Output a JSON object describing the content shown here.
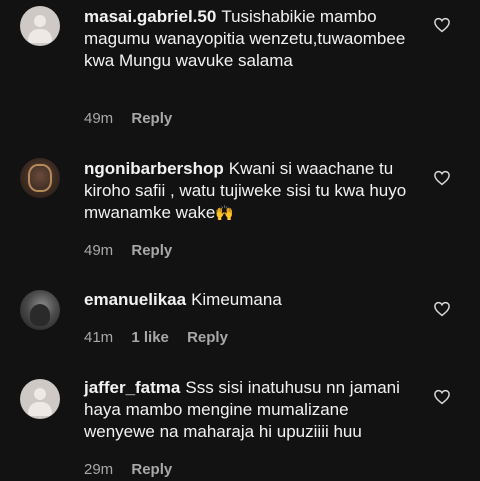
{
  "comments": [
    {
      "username": "masai.gabriel.50",
      "text": "Tusishabikie mambo magumu wanayopitia wenzetu,tuwaombee kwa Mungu wavuke salama",
      "time": "49m",
      "likes": "",
      "reply": "Reply"
    },
    {
      "username": "ngonibarbershop",
      "text": "Kwani si waachane tu kiroho safii , watu tujiweke sisi tu kwa huyo mwanamke wake",
      "emoji": "🙌",
      "time": "49m",
      "likes": "",
      "reply": "Reply"
    },
    {
      "username": "emanuelikaa",
      "text": "Kimeumana",
      "time": "41m",
      "likes": "1 like",
      "reply": "Reply"
    },
    {
      "username": "jaffer_fatma",
      "text": "Sss sisi inatuhusu nn jamani haya mambo mengine mumalizane wenyewe na maharaja hi upuziiii huu",
      "time": "29m",
      "likes": "",
      "reply": "Reply"
    }
  ],
  "icons": {
    "like": "heart-outline-icon",
    "avatar_default": "default-avatar-icon"
  },
  "colors": {
    "background": "#121212",
    "text": "#f2f2f2",
    "meta": "#a8a8a8"
  }
}
